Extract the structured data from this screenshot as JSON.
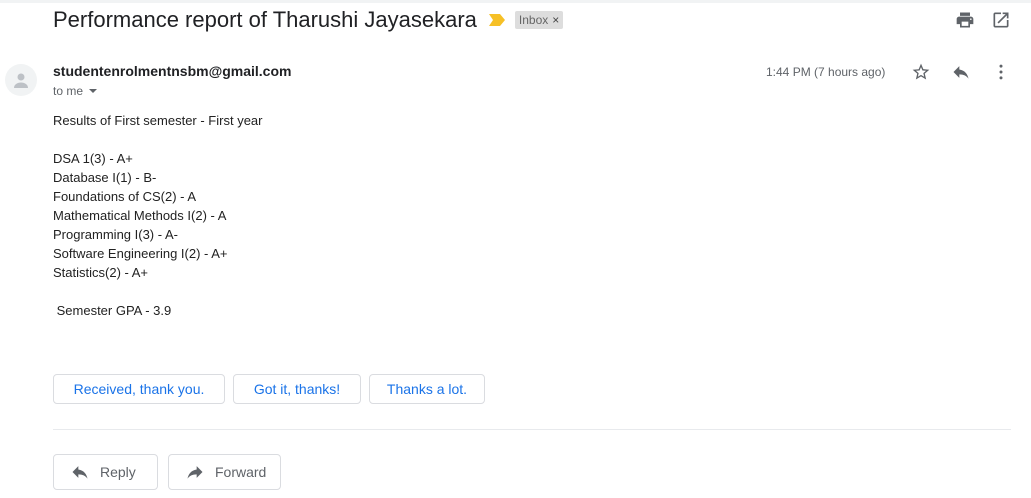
{
  "thread": {
    "subject": "Performance report of Tharushi Jayasekara",
    "label": "Inbox",
    "label_remove": "×"
  },
  "message": {
    "sender": "studentenrolmentnsbm@gmail.com",
    "to": "to me",
    "time": "1:44 PM (7 hours ago)",
    "body_lines": [
      "Results of First semester - First year",
      "",
      "DSA 1(3) - A+",
      "Database I(1) - B-",
      "Foundations of CS(2) - A",
      "Mathematical Methods I(2) - A",
      "Programming I(3) - A-",
      "Software Engineering I(2) - A+",
      "Statistics(2) - A+",
      "",
      " Semester GPA - 3.9"
    ]
  },
  "smart_replies": [
    "Received, thank you.",
    "Got it, thanks!",
    "Thanks a lot."
  ],
  "actions": {
    "reply": "Reply",
    "forward": "Forward"
  },
  "colors": {
    "importance": "#f6c026",
    "link_blue": "#1a73e8",
    "icon_gray": "#5f6368"
  },
  "icons": [
    "print-icon",
    "open-new-window-icon",
    "star-icon",
    "reply-icon",
    "more-vert-icon",
    "forward-icon",
    "person-icon",
    "importance-marker-icon"
  ]
}
